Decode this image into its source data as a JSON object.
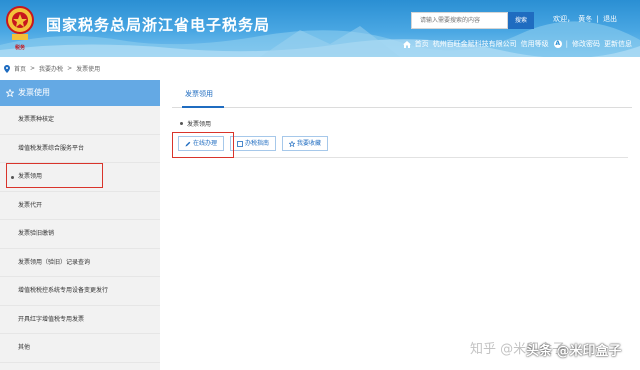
{
  "header": {
    "emblem_text": "税务",
    "site_title": "国家税务总局浙江省电子税务局",
    "search_placeholder": "请输入需要搜索的内容",
    "search_button": "搜索",
    "welcome": "欢迎，",
    "user_name": "黄冬",
    "separator": "|",
    "logout": "退出",
    "home": "首页",
    "company": "杭州百旺金赋科技有限公司",
    "credit_level_label": "信用等级",
    "credit_level_value": "A",
    "change_password": "修改密码",
    "update_data": "更新信息"
  },
  "breadcrumb": {
    "items": [
      "首页",
      ">",
      "我要办税",
      ">",
      "发票使用"
    ]
  },
  "sidebar": {
    "header": "发票使用",
    "items": [
      {
        "label": "发票票种核定"
      },
      {
        "label": "增值税发票综合服务平台"
      },
      {
        "label": "发票领用"
      },
      {
        "label": "发票代开"
      },
      {
        "label": "发票验旧缴销"
      },
      {
        "label": "发票领用（验旧）记录查询"
      },
      {
        "label": "增值税税控系统专用设备变更发行"
      },
      {
        "label": "开具红字增值税专用发票"
      },
      {
        "label": "其他"
      }
    ]
  },
  "main": {
    "tab": "发票领用",
    "section": "发票领用",
    "buttons": {
      "online": "在线办理",
      "guide": "办税指南",
      "favorite": "我要收藏"
    }
  },
  "watermark": {
    "zhihu": "知乎 @米印盒子",
    "toutiao": "头条 @米印盒子"
  },
  "colors": {
    "header_blue": "#2a8fd3",
    "sidebar_header": "#64a9e4",
    "link_blue": "#1f6cc0",
    "highlight_red": "#d9342b"
  }
}
